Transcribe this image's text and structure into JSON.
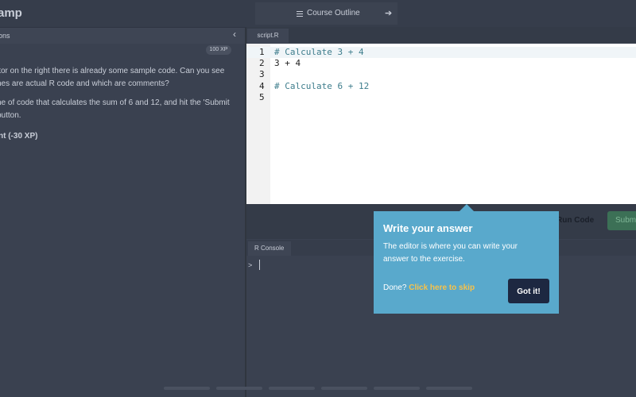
{
  "header": {
    "logo_text": "amp",
    "course_outline_label": "Course Outline"
  },
  "left": {
    "header_text": "ons",
    "xp_badge": "100 XP",
    "paragraphs": [
      "itor on the right there is already some sample code. Can you see\nnes are actual R code and which are comments?",
      "ne of code that calculates the sum of 6 and 12, and hit the 'Submit\nbutton."
    ],
    "hint": "nt (-30 XP)"
  },
  "editor": {
    "tab_label": "script.R",
    "lines": [
      {
        "num": "1",
        "text": "# Calculate 3 + 4",
        "comment": true
      },
      {
        "num": "2",
        "text": "3 + 4",
        "comment": false
      },
      {
        "num": "3",
        "text": "",
        "comment": false
      },
      {
        "num": "4",
        "text": "# Calculate 6 + 12",
        "comment": true
      },
      {
        "num": "5",
        "text": "",
        "comment": false
      }
    ]
  },
  "actions": {
    "run_label": "Run Code",
    "submit_label": "Subm"
  },
  "console": {
    "tab_label": "R Console",
    "prompt": ">"
  },
  "tooltip": {
    "title": "Write your answer",
    "body": "The editor is where you can write your\nanswer to the exercise.",
    "done_prefix": "Done?",
    "skip_label": "Click here to skip",
    "button_label": "Got it!"
  },
  "colors": {
    "tooltip_bg": "#59a9cc",
    "skip_link": "#f7c24a",
    "got_it_bg": "#1d2841",
    "comment_text": "#3e7d8c"
  }
}
